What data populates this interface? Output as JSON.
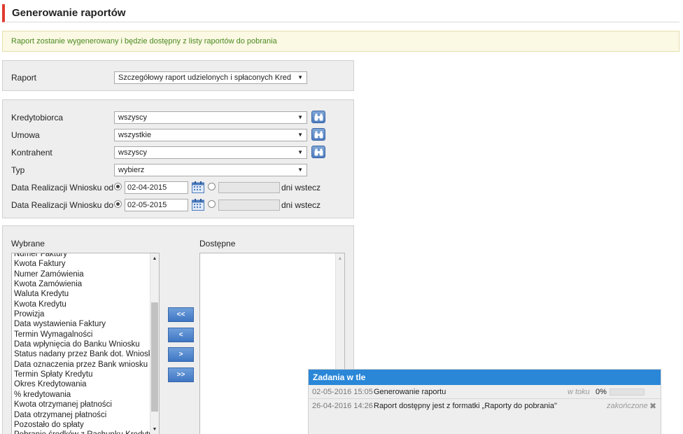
{
  "page": {
    "title": "Generowanie raportów"
  },
  "info": {
    "message": "Raport zostanie wygenerowany i będzie dostępny z listy raportów do pobrania"
  },
  "report": {
    "label": "Raport",
    "value": "Szczegółowy raport udzielonych i spłaconych Kred"
  },
  "filters": {
    "kredytobiorca": {
      "label": "Kredytobiorca",
      "value": "wszyscy"
    },
    "umowa": {
      "label": "Umowa",
      "value": "wszystkie"
    },
    "kontrahent": {
      "label": "Kontrahent",
      "value": "wszyscy"
    },
    "typ": {
      "label": "Typ",
      "value": "wybierz"
    },
    "date_from": {
      "label": "Data Realizacji Wniosku od",
      "value": "02-04-2015",
      "suffix": "dni wstecz"
    },
    "date_to": {
      "label": "Data Realizacji Wniosku do",
      "value": "02-05-2015",
      "suffix": "dni wstecz"
    }
  },
  "columns": {
    "selected_label": "Wybrane",
    "available_label": "Dostępne",
    "selected_items": [
      "Numer Faktury",
      "Kwota Faktury",
      "Numer Zamówienia",
      "Kwota Zamówienia",
      "Waluta Kredytu",
      "Kwota Kredytu",
      "Prowizja",
      "Data wystawienia Faktury",
      "Termin Wymagalności",
      "Data wpłynięcia do Banku Wniosku",
      "Status nadany przez Bank dot. Wniosku",
      "Data oznaczenia przez Bank wniosku",
      "Termin Spłaty Kredytu",
      "Okres Kredytowania",
      "% kredytowania",
      "Kwota otrzymanej płatności",
      "Data otrzymanej płatności",
      "Pozostało do spłaty",
      "Pobranie środków z Rachunku Kredytu"
    ],
    "buttons": {
      "add_all": "<<",
      "add": "<",
      "remove": ">",
      "remove_all": ">>"
    }
  },
  "tasks": {
    "title": "Zadania w tle",
    "rows": [
      {
        "date": "02-05-2016 15:05",
        "description": "Generowanie raportu",
        "status": "w toku",
        "percent": "0%",
        "progress": 0
      },
      {
        "date": "26-04-2016 14:26",
        "description": "Raport dostępny jest z formatki „Raporty do pobrania\"",
        "status": "zakończone"
      }
    ]
  },
  "colors": {
    "accent_red": "#e03b2f",
    "header_blue": "#2a87d8",
    "button_blue": "#3f76c3",
    "info_green": "#4a8b1f"
  }
}
